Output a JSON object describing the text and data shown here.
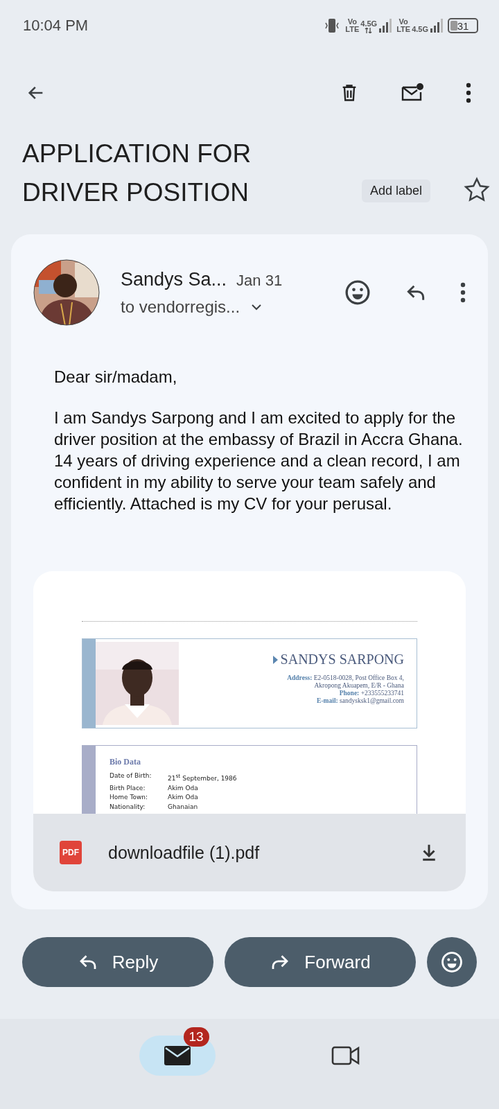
{
  "status_bar": {
    "time": "10:04 PM",
    "sims": [
      {
        "volte_top": "Vo",
        "volte_bottom": "LTE",
        "network": "4.5G",
        "arrows": true
      },
      {
        "volte_top": "Vo",
        "volte_bottom": "LTE",
        "network": "4.5G",
        "arrows": false
      }
    ],
    "battery": "31"
  },
  "subject": {
    "title": "APPLICATION FOR DRIVER POSITION",
    "label_button": "Add label",
    "starred": false
  },
  "message": {
    "sender": "Sandys Sa...",
    "date": "Jan 31",
    "recipient": "to vendorregis...",
    "body": [
      "Dear sir/madam,",
      "I am Sandys Sarpong and I am excited to apply for the driver position at the embassy of Brazil in Accra Ghana. 14 years of driving experience and a clean record, I am confident in my ability to serve your team safely and efficiently. Attached is my CV for your perusal."
    ],
    "attachment": {
      "name": "SANDYS SARPONG",
      "contact": [
        {
          "label": "Address:",
          "value": "E2-0518-0028, Post Office Box 4,"
        },
        {
          "value": "Akropong Akuapem, E/R - Ghana"
        },
        {
          "label": "Phone:",
          "value": "+233555233741"
        },
        {
          "label": "E-mail:",
          "value": "sandysksk1@gmail.com"
        }
      ],
      "section": "Bio Data",
      "rows": [
        {
          "key": "Date of Birth:",
          "value": "21$^{st}$ September, 1986"
        },
        {
          "key": "Birth Place:",
          "value": "Akim Oda"
        },
        {
          "key": "Home Town:",
          "value": "Akim Oda"
        },
        {
          "key": "Nationality:",
          "value": "Ghanaian"
        }
      ],
      "file_type": "PDF",
      "file_name": "downloadfile (1).pdf"
    }
  },
  "actions": [
    "Reply",
    "Forward"
  ],
  "bottom_nav": [
    {
      "kind": "mail",
      "selected": true,
      "badge": "13"
    },
    {
      "kind": "meet",
      "selected": false
    }
  ]
}
